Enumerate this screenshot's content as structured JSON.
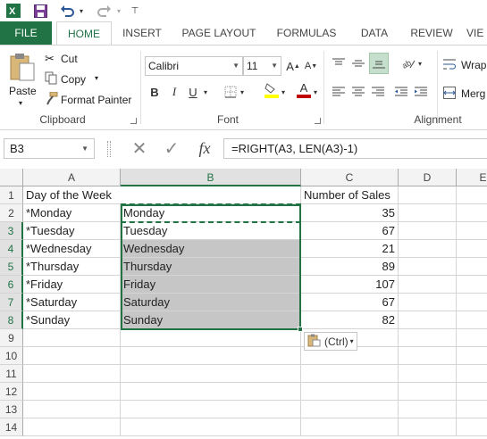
{
  "quick_access": {
    "excel_icon": "excel-logo-icon",
    "save_icon": "save-icon",
    "undo_icon": "undo-icon",
    "redo_icon": "redo-icon"
  },
  "tabs": [
    "FILE",
    "HOME",
    "INSERT",
    "PAGE LAYOUT",
    "FORMULAS",
    "DATA",
    "REVIEW",
    "VIE"
  ],
  "active_tab": "HOME",
  "ribbon": {
    "clipboard": {
      "paste_label": "Paste",
      "cut_label": "Cut",
      "copy_label": "Copy",
      "format_painter_label": "Format Painter",
      "group_label": "Clipboard"
    },
    "font": {
      "font_name": "Calibri",
      "font_size": "11",
      "bold": "B",
      "italic": "I",
      "underline": "U",
      "font_color_glyph": "A",
      "grow_glyph": "A",
      "shrink_glyph": "A",
      "group_label": "Font"
    },
    "alignment": {
      "wrap_label": "Wrap",
      "merge_label": "Merg",
      "group_label": "Alignment"
    }
  },
  "formula_bar": {
    "name_box": "B3",
    "cancel_glyph": "✕",
    "enter_glyph": "✓",
    "fx_label": "fx",
    "formula": "=RIGHT(A3, LEN(A3)-1)"
  },
  "grid": {
    "columns": [
      "A",
      "B",
      "C",
      "D",
      "E"
    ],
    "rows": [
      "1",
      "2",
      "3",
      "4",
      "5",
      "6",
      "7",
      "8",
      "9",
      "10",
      "11",
      "12",
      "13",
      "14"
    ],
    "cells": {
      "A1": "Day of the Week",
      "C1": "Number of Sales",
      "A2": "*Monday",
      "B2": "Monday",
      "C2": "35",
      "A3": "*Tuesday",
      "B3": "Tuesday",
      "C3": "67",
      "A4": "*Wednesday",
      "B4": "Wednesday",
      "C4": "21",
      "A5": "*Thursday",
      "B5": "Thursday",
      "C5": "89",
      "A6": "*Friday",
      "B6": "Friday",
      "C6": "107",
      "A7": "*Saturday",
      "B7": "Saturday",
      "C7": "67",
      "A8": "*Sunday",
      "B8": "Sunday",
      "C8": "82"
    },
    "paste_options_label": "(Ctrl)"
  },
  "colors": {
    "accent": "#217346",
    "selection_shade": "#c6c6c6",
    "font_color_bar": "#c00000",
    "highlight_bar": "#ffff00"
  }
}
